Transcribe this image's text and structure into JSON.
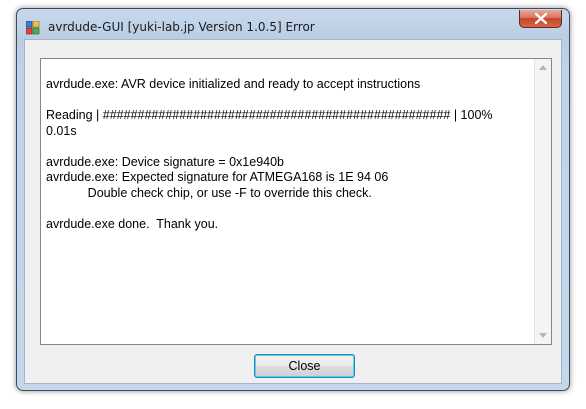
{
  "window": {
    "title": "avrdude-GUI [yuki-lab.jp Version 1.0.5] Error"
  },
  "output": {
    "lines": [
      "",
      "avrdude.exe: AVR device initialized and ready to accept instructions",
      "",
      "Reading | ################################################## | 100%",
      "0.01s",
      "",
      "avrdude.exe: Device signature = 0x1e940b",
      "avrdude.exe: Expected signature for ATMEGA168 is 1E 94 06",
      "            Double check chip, or use -F to override this check.",
      "",
      "avrdude.exe done.  Thank you.",
      ""
    ]
  },
  "buttons": {
    "close_label": "Close"
  },
  "icons": {
    "app": "app-icon",
    "window_close": "close-icon",
    "scroll_up": "scroll-up-arrow-icon",
    "scroll_down": "scroll-down-arrow-icon"
  },
  "colors": {
    "title_bar": "#bfd2e8",
    "close_button": "#c7432a",
    "button_focus_border": "#3c7fb1"
  }
}
